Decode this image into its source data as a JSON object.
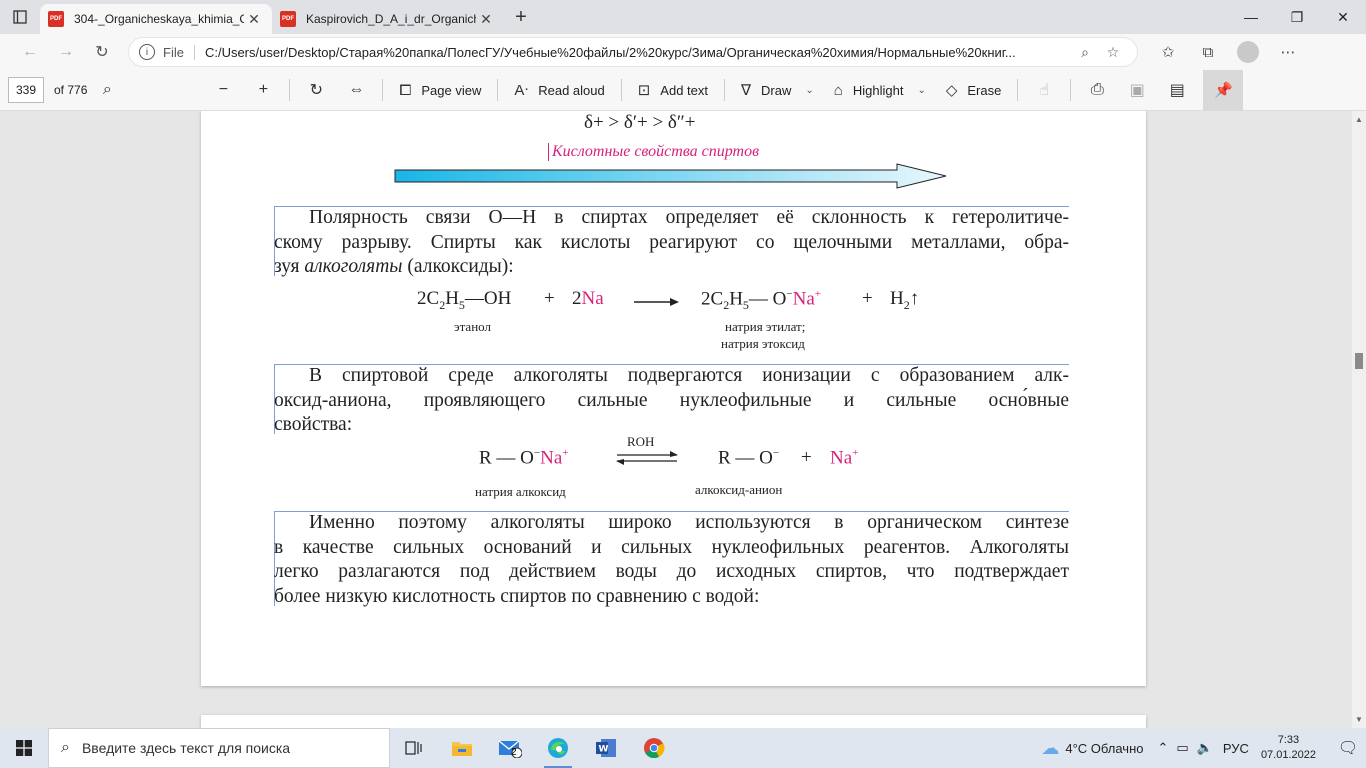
{
  "tabs": [
    {
      "title": "304-_Organicheskaya_khimia_Ch",
      "active": true
    },
    {
      "title": "Kaspirovich_D_A_i_dr_Organichec",
      "active": false
    }
  ],
  "address": {
    "file_label": "File",
    "url": "C:/Users/user/Desktop/Старая%20папка/ПолесГУ/Учебные%20файлы/2%20курс/Зима/Органическая%20химия/Нормальные%20книг..."
  },
  "pdf_toolbar": {
    "page_value": "339",
    "page_total": "of 776",
    "page_view": "Page view",
    "read_aloud": "Read aloud",
    "add_text": "Add text",
    "draw": "Draw",
    "highlight": "Highlight",
    "erase": "Erase"
  },
  "document": {
    "delta_line": "δ+ > δ′+ > δ″+",
    "acid_label": "Кислотные свойства спиртов",
    "para1": [
      "Полярность связи O—H в спиртах определяет её склонность к гетеролитиче-",
      "скому разрыву. Спирты как кислоты реагируют со щелочными металлами, обра-"
    ],
    "para1_last_prefix": "зуя ",
    "para1_last_italic": "алкоголяты",
    "para1_last_suffix": " (алкоксиды):",
    "eq1": {
      "coef1": "2C",
      "sub2": "2",
      "h": "H",
      "sub5": "5",
      "oh": "—OH",
      "plus1": "+",
      "coef2": "2",
      "na": "Na",
      "prod_coef": "2C",
      "prod_sub2": "2",
      "prod_h": "H",
      "prod_sub5": "5",
      "prod_bond": "—",
      "prod_o": "O",
      "minus": "−",
      "prod_na": "Na",
      "plus_sup": "+",
      "plus2": "+",
      "h2": "H",
      "h2_sub": "2",
      "gas": "↑",
      "label_ethanol": "этанол",
      "label_ethylate": "натрия этилат;",
      "label_ethoxide": "натрия этоксид"
    },
    "para2": [
      "В спиртовой среде алкоголяты подвергаются ионизации с образованием алк-",
      "оксид-аниона, проявляющего сильные нуклеофильные и сильные осно́вные",
      "свойства:"
    ],
    "eq2": {
      "r1": "R — O",
      "minus": "−",
      "na": "Na",
      "plus_sup": "+",
      "solvent": "ROH",
      "r2": "R — O",
      "minus2": "−",
      "plus": "+",
      "na2": "Na",
      "plus_sup2": "+",
      "label_alkoxide": "натрия алкоксид",
      "label_anion": "алкоксид-анион"
    },
    "para3": [
      "Именно поэтому алкоголяты широко используются в органическом синтезе",
      "в качестве сильных оснований и сильных нуклеофильных реагентов. Алкоголяты",
      "легко разлагаются под действием воды до исходных спиртов, что подтверждает",
      "более низкую кислотность спиртов по сравнению с водой:"
    ]
  },
  "taskbar": {
    "search_placeholder": "Введите здесь текст для поиска",
    "mail_badge": "2",
    "weather": "4°C  Облачно",
    "lang": "РУС",
    "time": "7:33",
    "date": "07.01.2022"
  },
  "colors": {
    "accent_pink": "#d8227a",
    "highlight_line": "#7d9fd2",
    "arrow_start": "#19b6e6",
    "arrow_end": "#e8f7fd"
  }
}
